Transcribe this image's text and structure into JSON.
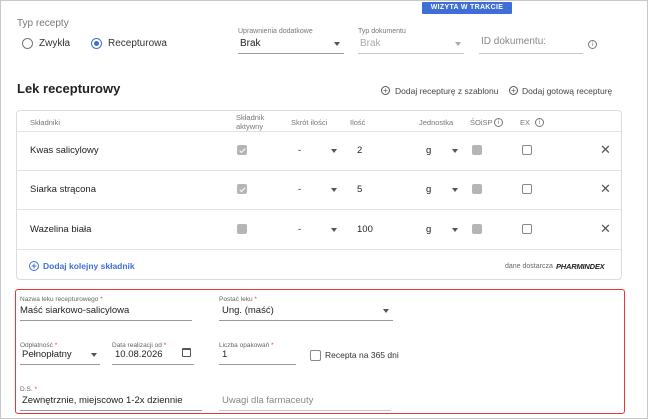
{
  "banner": "WIZYTA W TRAKCIE",
  "prescription_type": {
    "label": "Typ recepty",
    "options": [
      {
        "label": "Zwykła",
        "selected": false
      },
      {
        "label": "Recepturowa",
        "selected": true
      }
    ]
  },
  "extra_rights": {
    "label": "Uprawnienia dodatkowe",
    "value": "Brak"
  },
  "document_type": {
    "label": "Typ dokumentu",
    "value": "Brak"
  },
  "document_id": {
    "placeholder": "ID dokumentu:"
  },
  "section": {
    "title": "Lek recepturowy",
    "add_from_template": "Dodaj recepturę z szablonu",
    "add_ready": "Dodaj gotową recepturę"
  },
  "table": {
    "headers": {
      "ingredient": "Składniki",
      "active_line1": "Składnik",
      "active_line2": "aktywny",
      "shortcut": "Skrót ilości",
      "quantity": "Ilość",
      "unit": "Jednostka",
      "soisp": "ŚOiSP",
      "ex": "EX"
    },
    "rows": [
      {
        "name": "Kwas salicylowy",
        "active": true,
        "shortcut": "-",
        "qty": "2",
        "unit": "g"
      },
      {
        "name": "Siarka strącona",
        "active": true,
        "shortcut": "-",
        "qty": "5",
        "unit": "g"
      },
      {
        "name": "Wazelina biała",
        "active": false,
        "shortcut": "-",
        "qty": "100",
        "unit": "g"
      }
    ],
    "add_ingredient": "Dodaj kolejny składnik",
    "supplier_prefix": "dane dostarcza",
    "supplier_brand": "PHARMINDEX"
  },
  "form": {
    "name": {
      "label": "Nazwa leku recepturowego",
      "value": "Maść siarkowo-salicylowa"
    },
    "form_type": {
      "label": "Postać leku",
      "value": "Ung. (maść)"
    },
    "payment": {
      "label": "Odpłatność",
      "value": "Pełnopłatny"
    },
    "date": {
      "label": "Data realizacji od",
      "value": "10.08.2026"
    },
    "packages": {
      "label": "Liczba opakowań",
      "value": "1"
    },
    "recipe365": {
      "label": "Recepta na 365 dni"
    },
    "ds": {
      "label": "D.S.",
      "value": "Zewnętrznie, miejscowo 1-2x dziennie"
    },
    "pharmacist_notes": {
      "placeholder": "Uwagi dla farmaceuty"
    }
  },
  "colors": {
    "accent": "#3f6fd6",
    "highlight": "#e53935"
  }
}
